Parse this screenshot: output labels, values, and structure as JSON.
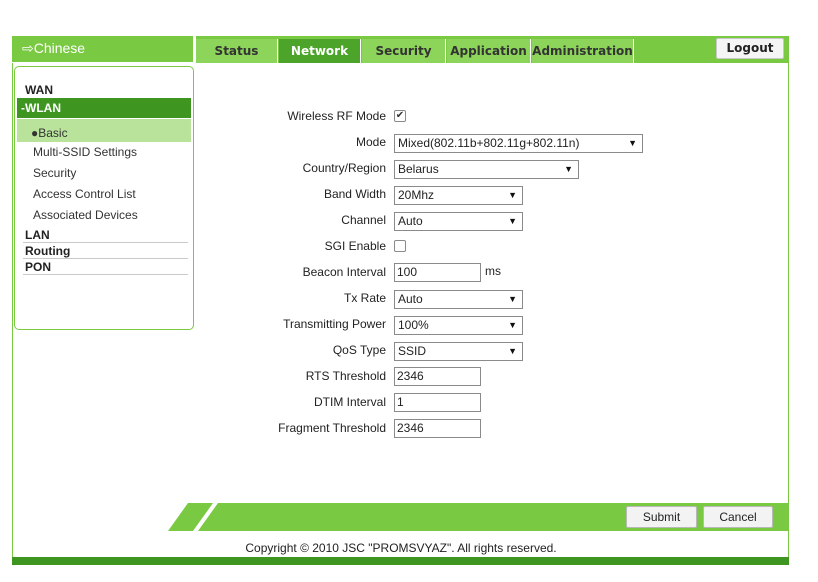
{
  "header": {
    "language_link": "⇨Chinese",
    "tabs": [
      {
        "label": "Status",
        "active": false
      },
      {
        "label": "Network",
        "active": true
      },
      {
        "label": "Security",
        "active": false
      },
      {
        "label": "Application",
        "active": false
      },
      {
        "label": "Administration",
        "active": false
      }
    ],
    "logout_label": "Logout"
  },
  "sidebar": {
    "wan": "WAN",
    "wlan": "-WLAN",
    "wlan_items": [
      "●Basic",
      "Multi-SSID Settings",
      "Security",
      "Access Control List",
      "Associated Devices"
    ],
    "lan": "LAN",
    "routing": "Routing",
    "pon": "PON"
  },
  "form": {
    "wireless_rf_mode": {
      "label": "Wireless RF Mode",
      "checked": true
    },
    "mode": {
      "label": "Mode",
      "value": "Mixed(802.11b+802.11g+802.11n)"
    },
    "country_region": {
      "label": "Country/Region",
      "value": "Belarus"
    },
    "band_width": {
      "label": "Band Width",
      "value": "20Mhz"
    },
    "channel": {
      "label": "Channel",
      "value": "Auto"
    },
    "sgi_enable": {
      "label": "SGI Enable",
      "checked": false
    },
    "beacon_interval": {
      "label": "Beacon Interval",
      "value": "100",
      "unit": "ms"
    },
    "tx_rate": {
      "label": "Tx Rate",
      "value": "Auto"
    },
    "transmitting_power": {
      "label": "Transmitting Power",
      "value": "100%"
    },
    "qos_type": {
      "label": "QoS Type",
      "value": "SSID"
    },
    "rts_threshold": {
      "label": "RTS Threshold",
      "value": "2346"
    },
    "dtim_interval": {
      "label": "DTIM Interval",
      "value": "1"
    },
    "fragment_threshold": {
      "label": "Fragment Threshold",
      "value": "2346"
    }
  },
  "buttons": {
    "submit": "Submit",
    "cancel": "Cancel"
  },
  "footer": {
    "copyright": "Copyright © 2010 JSC \"PROMSVYAZ\". All rights reserved."
  },
  "colors": {
    "accent": "#7ac943",
    "accent_dark": "#3e9621",
    "active_tab": "#4ca42a",
    "selected_item": "#b9e39b"
  },
  "icons": {
    "checkbox_checked": "check-icon",
    "dropdown": "chevron-down-icon"
  }
}
